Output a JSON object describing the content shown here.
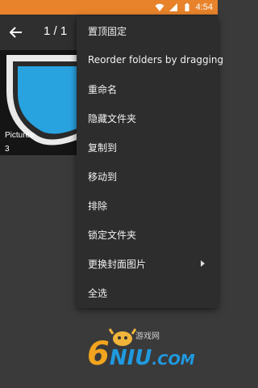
{
  "status_bar": {
    "time": "4:54",
    "icons": [
      "wifi-icon",
      "signal-icon",
      "battery-icon"
    ]
  },
  "app_bar": {
    "back_icon": "arrow-left-icon",
    "counter": "1 / 1"
  },
  "folder": {
    "name": "Pictures",
    "count": "3"
  },
  "menu": {
    "items": [
      {
        "label": "置顶固定"
      },
      {
        "label": "Reorder folders by dragging"
      },
      {
        "label": "重命名"
      },
      {
        "label": "隐藏文件夹"
      },
      {
        "label": "复制到"
      },
      {
        "label": "移动到"
      },
      {
        "label": "排除"
      },
      {
        "label": "锁定文件夹"
      },
      {
        "label": "更换封面图片",
        "has_submenu": true
      },
      {
        "label": "全选"
      }
    ]
  },
  "watermark": {
    "text": "6NIU.COM",
    "subtext": "游戏网"
  },
  "colors": {
    "status_bar": "#e8832b",
    "app_bar": "#2f2f2f",
    "background": "#3a3a3a",
    "menu": "#2d2d2d",
    "folder_icon": "#29a3e0"
  }
}
